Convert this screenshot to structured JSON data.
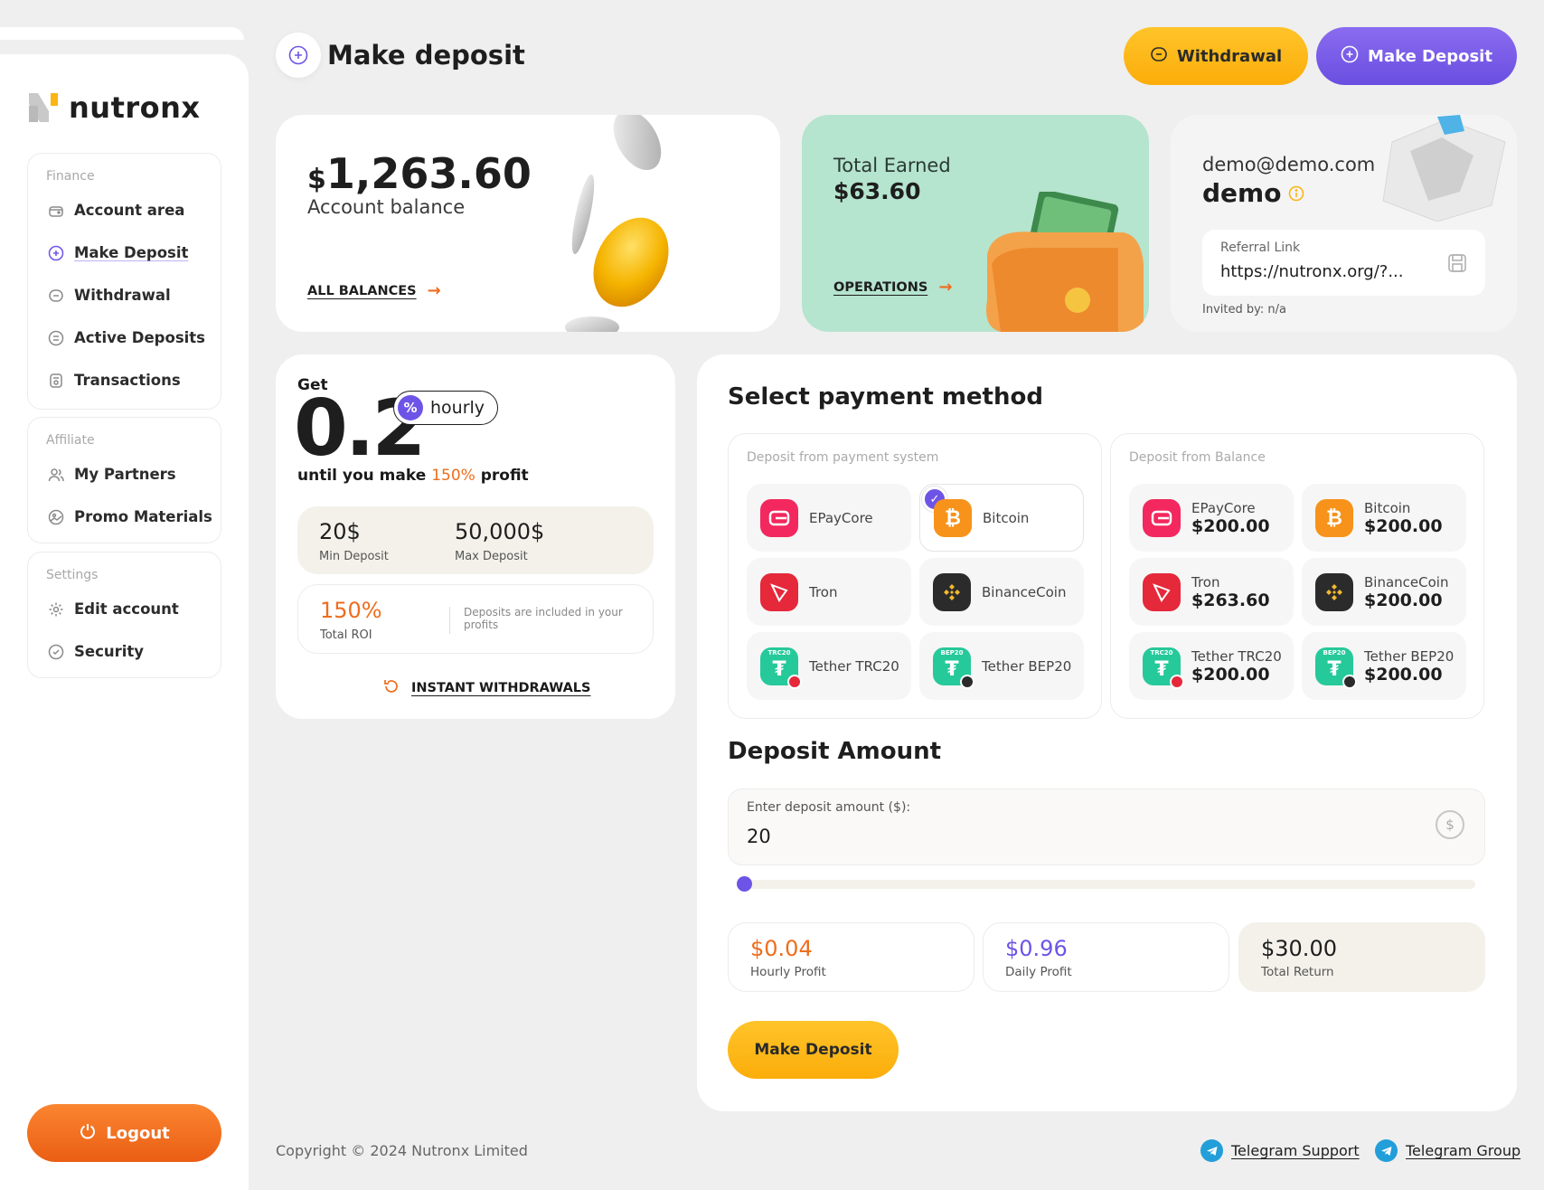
{
  "brand": {
    "name": "nutronx"
  },
  "sidebar": {
    "groups": [
      {
        "title": "Finance",
        "items": [
          {
            "label": "Account area",
            "icon": "wallet-icon"
          },
          {
            "label": "Make Deposit",
            "icon": "plus-circle-icon",
            "active": true
          },
          {
            "label": "Withdrawal",
            "icon": "withdraw-icon"
          },
          {
            "label": "Active Deposits",
            "icon": "list-icon"
          },
          {
            "label": "Transactions",
            "icon": "receipt-icon"
          }
        ]
      },
      {
        "title": "Affiliate",
        "items": [
          {
            "label": "My Partners",
            "icon": "users-icon"
          },
          {
            "label": "Promo Materials",
            "icon": "image-icon"
          }
        ]
      },
      {
        "title": "Settings",
        "items": [
          {
            "label": "Edit account",
            "icon": "gear-icon"
          },
          {
            "label": "Security",
            "icon": "shield-check-icon"
          }
        ]
      }
    ],
    "logout_label": "Logout"
  },
  "header": {
    "title": "Make deposit",
    "withdrawal_label": "Withdrawal",
    "deposit_label": "Make Deposit"
  },
  "balance": {
    "currency_symbol": "$",
    "amount": "1,263.60",
    "label": "Account balance",
    "link": "ALL BALANCES"
  },
  "earned": {
    "label": "Total Earned",
    "amount": "$63.60",
    "link": "OPERATIONS"
  },
  "profile": {
    "email": "demo@demo.com",
    "username": "demo",
    "referral_label": "Referral Link",
    "referral_value": "https://nutronx.org/?...",
    "invited_by": "Invited by: n/a"
  },
  "plan": {
    "get": "Get",
    "rate": "0.2",
    "period": "hourly",
    "until_prefix": "until you make",
    "profit_pct": "150%",
    "until_suffix": "profit",
    "min_value": "20$",
    "min_label": "Min Deposit",
    "max_value": "50,000$",
    "max_label": "Max Deposit",
    "roi_value": "150%",
    "roi_label": "Total ROI",
    "roi_note": "Deposits are included in your profits",
    "instant_label": "INSTANT WITHDRAWALS"
  },
  "payment": {
    "title": "Select payment method",
    "system_panel_title": "Deposit from payment system",
    "balance_panel_title": "Deposit from Balance",
    "system_methods": [
      {
        "name": "EPayCore",
        "icon": "epaycore-icon"
      },
      {
        "name": "Bitcoin",
        "icon": "bitcoin-icon",
        "selected": true
      },
      {
        "name": "Tron",
        "icon": "tron-icon"
      },
      {
        "name": "BinanceCoin",
        "icon": "binance-icon"
      },
      {
        "name": "Tether TRC20",
        "icon": "tether-trc20-icon"
      },
      {
        "name": "Tether BEP20",
        "icon": "tether-bep20-icon"
      }
    ],
    "balance_methods": [
      {
        "name": "EPayCore",
        "amount": "$200.00",
        "icon": "epaycore-icon"
      },
      {
        "name": "Bitcoin",
        "amount": "$200.00",
        "icon": "bitcoin-icon"
      },
      {
        "name": "Tron",
        "amount": "$263.60",
        "icon": "tron-icon"
      },
      {
        "name": "BinanceCoin",
        "amount": "$200.00",
        "icon": "binance-icon"
      },
      {
        "name": "Tether TRC20",
        "amount": "$200.00",
        "icon": "tether-trc20-icon"
      },
      {
        "name": "Tether BEP20",
        "amount": "$200.00",
        "icon": "tether-bep20-icon"
      }
    ]
  },
  "deposit": {
    "title": "Deposit Amount",
    "field_label": "Enter deposit amount ($):",
    "field_value": "20",
    "slider_fraction": 0,
    "hourly_value": "$0.04",
    "hourly_label": "Hourly Profit",
    "daily_value": "$0.96",
    "daily_label": "Daily Profit",
    "total_value": "$30.00",
    "total_label": "Total Return",
    "button_label": "Make Deposit"
  },
  "footer": {
    "copyright": "Copyright © 2024 Nutronx Limited",
    "telegram_support": "Telegram Support",
    "telegram_group": "Telegram Group"
  },
  "colors": {
    "accent_purple": "#6e54e6",
    "accent_orange": "#ee6d1c",
    "accent_yellow": "#fbb514",
    "mint": "#b5e4cf"
  },
  "ui": {
    "coin_labels": {
      "b": "₿",
      "trc": "TRC20",
      "bep": "BEP20"
    }
  }
}
